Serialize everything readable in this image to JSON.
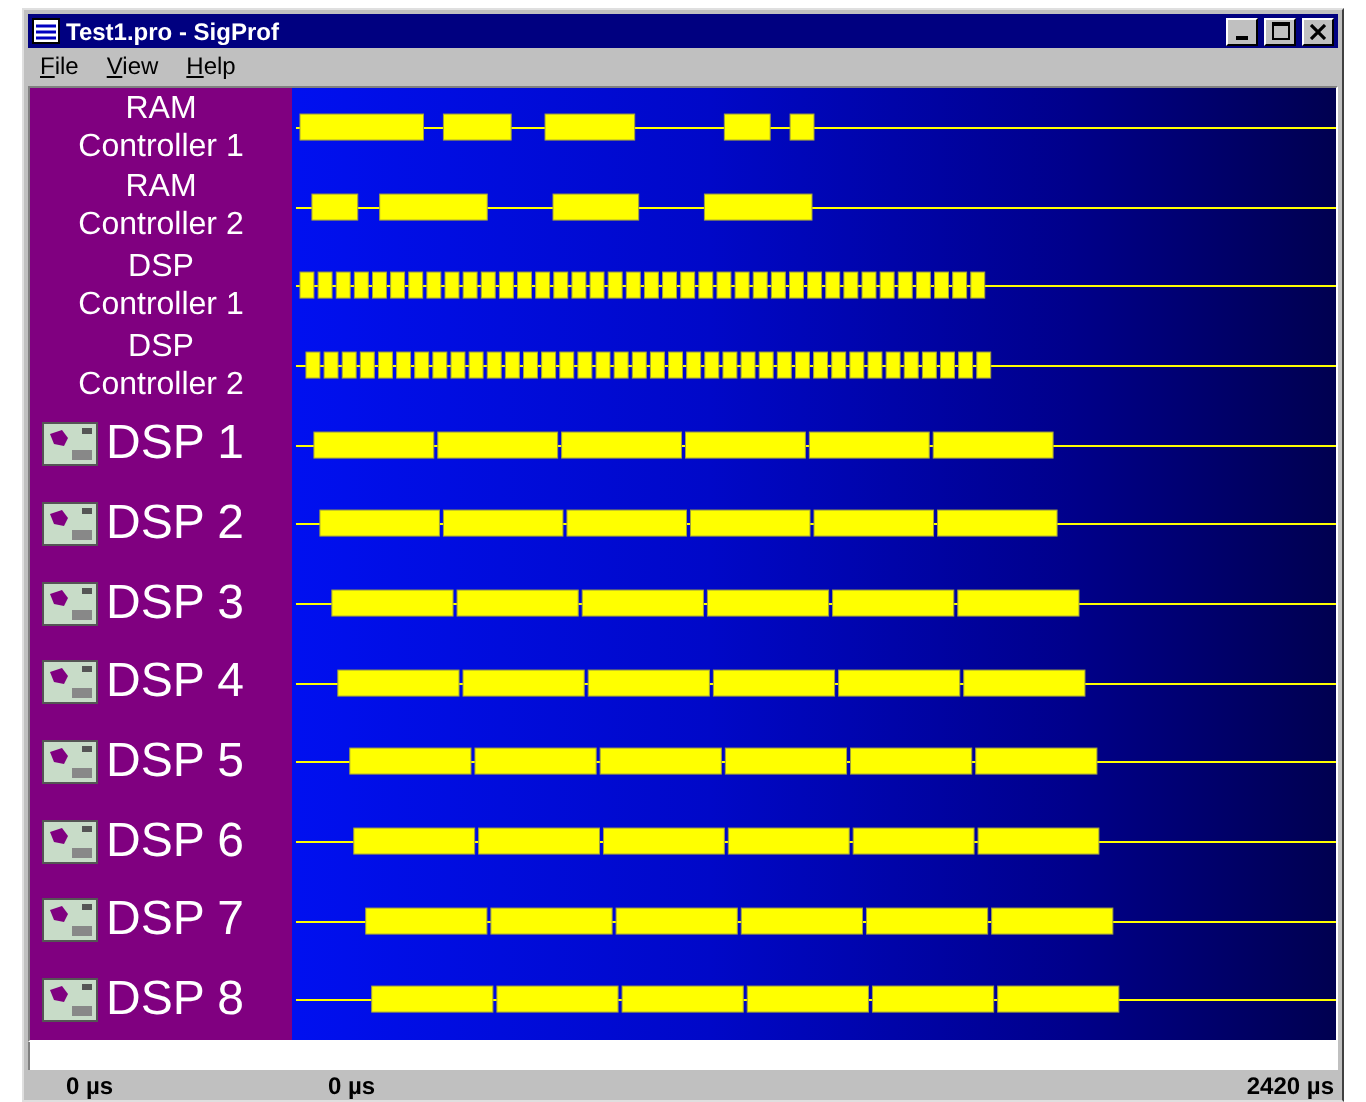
{
  "window": {
    "title": "Test1.pro - SigProf"
  },
  "menu": [
    "File",
    "View",
    "Help"
  ],
  "signals": [
    {
      "kind": "bus",
      "lines": [
        "RAM",
        "Controller 1"
      ]
    },
    {
      "kind": "bus",
      "lines": [
        "RAM",
        "Controller 2"
      ]
    },
    {
      "kind": "bus",
      "lines": [
        "DSP",
        "Controller 1"
      ]
    },
    {
      "kind": "bus",
      "lines": [
        "DSP",
        "Controller 2"
      ]
    },
    {
      "kind": "dsp",
      "label": "DSP 1"
    },
    {
      "kind": "dsp",
      "label": "DSP 2"
    },
    {
      "kind": "dsp",
      "label": "DSP 3"
    },
    {
      "kind": "dsp",
      "label": "DSP 4"
    },
    {
      "kind": "dsp",
      "label": "DSP 5"
    },
    {
      "kind": "dsp",
      "label": "DSP 6"
    },
    {
      "kind": "dsp",
      "label": "DSP 7"
    },
    {
      "kind": "dsp",
      "label": "DSP 8"
    }
  ],
  "status_bar": [
    "0 µs",
    "0 µs",
    "2420 µs"
  ]
}
